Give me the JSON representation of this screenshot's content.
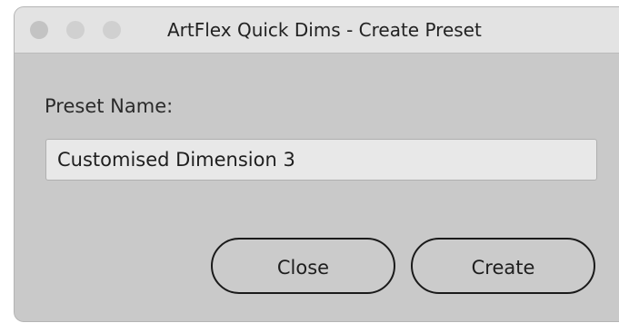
{
  "window": {
    "title": "ArtFlex Quick Dims - Create Preset"
  },
  "form": {
    "preset_label": "Preset Name:",
    "preset_value": "Customised Dimension 3"
  },
  "buttons": {
    "close_label": "Close",
    "create_label": "Create"
  },
  "colors": {
    "window_bg": "#c9c9c9",
    "titlebar_bg": "#e3e3e3",
    "input_bg": "#e8e8e8",
    "button_border": "#1a1a1a"
  },
  "icons": {
    "traffic_lights": [
      "close-dot-icon",
      "minimize-dot-icon",
      "zoom-dot-icon"
    ]
  }
}
